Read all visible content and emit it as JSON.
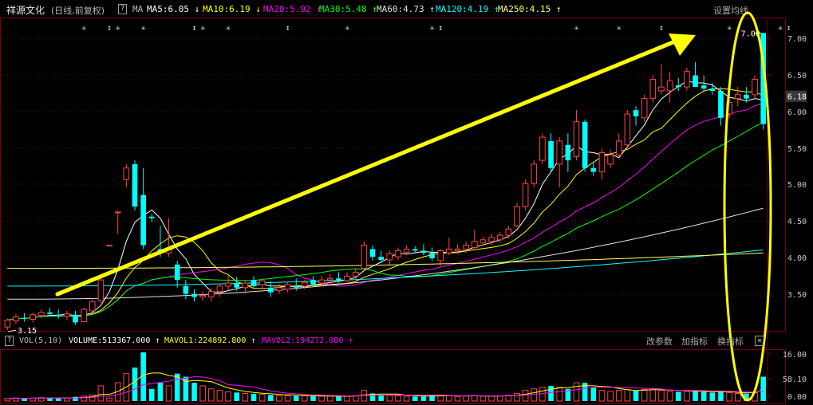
{
  "header": {
    "stock_name": "祥源文化",
    "mode": "(日线,前复权)",
    "help": "?",
    "ma_label": "MA",
    "ma_items": [
      {
        "text": "MA5:6.05 ↓",
        "color": "#ffffff"
      },
      {
        "text": "MA10:6.19 ↓",
        "color": "#ffff00"
      },
      {
        "text": "MA20:5.92 ↑",
        "color": "#ff00ff"
      },
      {
        "text": "MA30:5.48 ↑",
        "color": "#00ff00"
      },
      {
        "text": "MA60:4.73 ↑",
        "color": "#e0e0e0"
      },
      {
        "text": "MA120:4.19 ↑",
        "color": "#00ffff"
      },
      {
        "text": "MA250:4.15 ↑",
        "color": "#ffff66"
      }
    ],
    "settings": "设置均线"
  },
  "annotations": {
    "high_label": "7.00",
    "low_label": "3.15",
    "last_price": "6.18"
  },
  "volume_header": {
    "help": "?",
    "indicator": "VOL(5,10)",
    "volume": "VOLUME:513367.000 ↑",
    "mavol1": "MAVOL1:224892.800 ↑",
    "mavol2": "MAVOL2:194272.000 ↑",
    "btn_params": "改参数",
    "btn_add": "加指标",
    "btn_switch": "换指标",
    "btn_close": "×"
  },
  "chart_data": {
    "type": "candlestick",
    "price_axis": {
      "ticks": [
        "7.00",
        "6.50",
        "6.00",
        "5.50",
        "5.00",
        "4.50",
        "4.00",
        "3.50"
      ],
      "range": [
        3.13,
        7.2
      ]
    },
    "volume_axis": {
      "ticks": [
        "16.00",
        "58.10",
        "0.00"
      ],
      "range": [
        0,
        16.0
      ]
    },
    "candles": [
      {
        "o": 3.19,
        "h": 3.3,
        "l": 3.15,
        "c": 3.28,
        "v": 0.8
      },
      {
        "o": 3.27,
        "h": 3.36,
        "l": 3.23,
        "c": 3.32,
        "v": 1.0
      },
      {
        "o": 3.31,
        "h": 3.37,
        "l": 3.26,
        "c": 3.3,
        "v": 0.9
      },
      {
        "o": 3.29,
        "h": 3.38,
        "l": 3.25,
        "c": 3.35,
        "v": 1.0
      },
      {
        "o": 3.34,
        "h": 3.42,
        "l": 3.3,
        "c": 3.38,
        "v": 1.1
      },
      {
        "o": 3.38,
        "h": 3.44,
        "l": 3.33,
        "c": 3.36,
        "v": 1.0
      },
      {
        "o": 3.35,
        "h": 3.42,
        "l": 3.3,
        "c": 3.33,
        "v": 0.9
      },
      {
        "o": 3.33,
        "h": 3.4,
        "l": 3.28,
        "c": 3.36,
        "v": 1.0
      },
      {
        "o": 3.35,
        "h": 3.4,
        "l": 3.22,
        "c": 3.25,
        "v": 1.4
      },
      {
        "o": 3.26,
        "h": 3.44,
        "l": 3.25,
        "c": 3.42,
        "v": 1.6
      },
      {
        "o": 3.4,
        "h": 3.55,
        "l": 3.38,
        "c": 3.52,
        "v": 2.0
      },
      {
        "o": 3.53,
        "h": 3.85,
        "l": 3.5,
        "c": 3.8,
        "v": 5.0
      },
      {
        "o": 4.25,
        "h": 4.25,
        "l": 4.25,
        "c": 4.25,
        "v": 1.0
      },
      {
        "o": 4.68,
        "h": 4.7,
        "l": 4.4,
        "c": 4.68,
        "v": 6.0
      },
      {
        "o": 5.1,
        "h": 5.3,
        "l": 5.0,
        "c": 5.25,
        "v": 9.0
      },
      {
        "o": 5.3,
        "h": 5.35,
        "l": 4.7,
        "c": 4.75,
        "v": 11.0
      },
      {
        "o": 4.9,
        "h": 5.25,
        "l": 4.2,
        "c": 4.25,
        "v": 16.0
      },
      {
        "o": 4.62,
        "h": 4.65,
        "l": 4.55,
        "c": 4.6,
        "v": 4.0
      },
      {
        "o": 4.2,
        "h": 4.5,
        "l": 4.1,
        "c": 4.15,
        "v": 6.0
      },
      {
        "o": 4.15,
        "h": 4.6,
        "l": 4.1,
        "c": 4.2,
        "v": 5.0
      },
      {
        "o": 4.0,
        "h": 4.05,
        "l": 3.7,
        "c": 3.8,
        "v": 9.0
      },
      {
        "o": 3.72,
        "h": 3.8,
        "l": 3.55,
        "c": 3.62,
        "v": 8.0
      },
      {
        "o": 3.62,
        "h": 3.68,
        "l": 3.52,
        "c": 3.58,
        "v": 6.0
      },
      {
        "o": 3.58,
        "h": 3.65,
        "l": 3.53,
        "c": 3.6,
        "v": 5.0
      },
      {
        "o": 3.58,
        "h": 3.7,
        "l": 3.52,
        "c": 3.65,
        "v": 4.0
      },
      {
        "o": 3.65,
        "h": 3.75,
        "l": 3.58,
        "c": 3.72,
        "v": 3.5
      },
      {
        "o": 3.72,
        "h": 3.85,
        "l": 3.66,
        "c": 3.76,
        "v": 3.0
      },
      {
        "o": 3.76,
        "h": 3.84,
        "l": 3.66,
        "c": 3.7,
        "v": 2.8
      },
      {
        "o": 3.7,
        "h": 3.8,
        "l": 3.62,
        "c": 3.76,
        "v": 2.5
      },
      {
        "o": 3.8,
        "h": 3.85,
        "l": 3.7,
        "c": 3.72,
        "v": 2.4
      },
      {
        "o": 3.74,
        "h": 3.82,
        "l": 3.68,
        "c": 3.79,
        "v": 2.2
      },
      {
        "o": 3.7,
        "h": 3.78,
        "l": 3.58,
        "c": 3.64,
        "v": 2.0
      },
      {
        "o": 3.66,
        "h": 3.75,
        "l": 3.62,
        "c": 3.7,
        "v": 1.8
      },
      {
        "o": 3.68,
        "h": 3.78,
        "l": 3.64,
        "c": 3.74,
        "v": 1.8
      },
      {
        "o": 3.72,
        "h": 3.82,
        "l": 3.66,
        "c": 3.7,
        "v": 1.7
      },
      {
        "o": 3.72,
        "h": 3.8,
        "l": 3.68,
        "c": 3.77,
        "v": 1.7
      },
      {
        "o": 3.8,
        "h": 3.85,
        "l": 3.72,
        "c": 3.74,
        "v": 1.6
      },
      {
        "o": 3.76,
        "h": 3.85,
        "l": 3.72,
        "c": 3.8,
        "v": 1.6
      },
      {
        "o": 3.8,
        "h": 3.88,
        "l": 3.74,
        "c": 3.82,
        "v": 1.6
      },
      {
        "o": 3.82,
        "h": 3.9,
        "l": 3.76,
        "c": 3.79,
        "v": 1.5
      },
      {
        "o": 3.79,
        "h": 3.9,
        "l": 3.76,
        "c": 3.85,
        "v": 1.6
      },
      {
        "o": 3.85,
        "h": 3.95,
        "l": 3.8,
        "c": 3.9,
        "v": 1.8
      },
      {
        "o": 3.95,
        "h": 4.3,
        "l": 3.92,
        "c": 4.25,
        "v": 3.5
      },
      {
        "o": 4.2,
        "h": 4.25,
        "l": 4.05,
        "c": 4.1,
        "v": 2.5
      },
      {
        "o": 4.1,
        "h": 4.18,
        "l": 4.02,
        "c": 4.06,
        "v": 2.0
      },
      {
        "o": 4.06,
        "h": 4.18,
        "l": 4.0,
        "c": 4.14,
        "v": 1.8
      },
      {
        "o": 4.1,
        "h": 4.22,
        "l": 4.06,
        "c": 4.18,
        "v": 1.7
      },
      {
        "o": 4.16,
        "h": 4.25,
        "l": 4.12,
        "c": 4.2,
        "v": 1.6
      },
      {
        "o": 4.2,
        "h": 4.24,
        "l": 4.16,
        "c": 4.18,
        "v": 1.5
      },
      {
        "o": 4.18,
        "h": 4.26,
        "l": 4.12,
        "c": 4.15,
        "v": 1.5
      },
      {
        "o": 4.15,
        "h": 4.22,
        "l": 4.05,
        "c": 4.08,
        "v": 1.8
      },
      {
        "o": 4.05,
        "h": 4.2,
        "l": 3.98,
        "c": 4.18,
        "v": 2.0
      },
      {
        "o": 4.15,
        "h": 4.35,
        "l": 4.12,
        "c": 4.2,
        "v": 1.8
      },
      {
        "o": 4.18,
        "h": 4.26,
        "l": 4.14,
        "c": 4.2,
        "v": 1.5
      },
      {
        "o": 4.2,
        "h": 4.3,
        "l": 4.15,
        "c": 4.25,
        "v": 1.6
      },
      {
        "o": 4.22,
        "h": 4.45,
        "l": 4.18,
        "c": 4.3,
        "v": 1.8
      },
      {
        "o": 4.28,
        "h": 4.36,
        "l": 4.25,
        "c": 4.32,
        "v": 1.6
      },
      {
        "o": 4.3,
        "h": 4.4,
        "l": 4.25,
        "c": 4.35,
        "v": 1.6
      },
      {
        "o": 4.32,
        "h": 4.42,
        "l": 4.28,
        "c": 4.38,
        "v": 1.7
      },
      {
        "o": 4.38,
        "h": 4.5,
        "l": 4.34,
        "c": 4.46,
        "v": 1.9
      },
      {
        "o": 4.5,
        "h": 4.8,
        "l": 4.48,
        "c": 4.75,
        "v": 2.5
      },
      {
        "o": 4.75,
        "h": 5.1,
        "l": 4.7,
        "c": 5.05,
        "v": 3.5
      },
      {
        "o": 5.05,
        "h": 5.35,
        "l": 5.0,
        "c": 5.3,
        "v": 4.0
      },
      {
        "o": 5.35,
        "h": 5.7,
        "l": 5.3,
        "c": 5.65,
        "v": 4.5
      },
      {
        "o": 5.6,
        "h": 5.7,
        "l": 5.2,
        "c": 5.25,
        "v": 5.0
      },
      {
        "o": 5.3,
        "h": 5.65,
        "l": 5.0,
        "c": 5.6,
        "v": 4.5
      },
      {
        "o": 5.55,
        "h": 5.7,
        "l": 5.2,
        "c": 5.35,
        "v": 4.0
      },
      {
        "o": 5.4,
        "h": 6.0,
        "l": 5.35,
        "c": 5.85,
        "v": 6.0
      },
      {
        "o": 5.85,
        "h": 5.88,
        "l": 5.2,
        "c": 5.25,
        "v": 6.0
      },
      {
        "o": 5.25,
        "h": 5.32,
        "l": 5.15,
        "c": 5.2,
        "v": 4.5
      },
      {
        "o": 5.2,
        "h": 5.5,
        "l": 5.1,
        "c": 5.45,
        "v": 3.5
      },
      {
        "o": 5.3,
        "h": 5.48,
        "l": 5.25,
        "c": 5.42,
        "v": 3.2
      },
      {
        "o": 5.42,
        "h": 5.7,
        "l": 5.4,
        "c": 5.6,
        "v": 3.5
      },
      {
        "o": 5.55,
        "h": 6.0,
        "l": 5.52,
        "c": 5.95,
        "v": 3.8
      },
      {
        "o": 6.0,
        "h": 6.05,
        "l": 5.8,
        "c": 5.92,
        "v": 3.5
      },
      {
        "o": 5.9,
        "h": 6.2,
        "l": 5.85,
        "c": 6.15,
        "v": 3.8
      },
      {
        "o": 6.15,
        "h": 6.45,
        "l": 6.1,
        "c": 6.4,
        "v": 4.0
      },
      {
        "o": 6.25,
        "h": 6.6,
        "l": 6.2,
        "c": 6.3,
        "v": 3.5
      },
      {
        "o": 6.25,
        "h": 6.5,
        "l": 6.1,
        "c": 6.38,
        "v": 3.2
      },
      {
        "o": 6.32,
        "h": 6.42,
        "l": 6.25,
        "c": 6.3,
        "v": 3.0
      },
      {
        "o": 6.3,
        "h": 6.55,
        "l": 6.25,
        "c": 6.5,
        "v": 3.2
      },
      {
        "o": 6.45,
        "h": 6.62,
        "l": 6.4,
        "c": 6.3,
        "v": 3.4
      },
      {
        "o": 6.32,
        "h": 6.45,
        "l": 6.25,
        "c": 6.28,
        "v": 3.0
      },
      {
        "o": 6.28,
        "h": 6.35,
        "l": 6.2,
        "c": 6.25,
        "v": 2.8
      },
      {
        "o": 6.25,
        "h": 6.3,
        "l": 5.8,
        "c": 5.9,
        "v": 3.2
      },
      {
        "o": 5.95,
        "h": 6.2,
        "l": 5.9,
        "c": 6.1,
        "v": 2.8
      },
      {
        "o": 6.15,
        "h": 6.3,
        "l": 6.05,
        "c": 6.2,
        "v": 2.5
      },
      {
        "o": 6.2,
        "h": 6.3,
        "l": 6.1,
        "c": 6.15,
        "v": 2.5
      },
      {
        "o": 6.2,
        "h": 6.45,
        "l": 6.15,
        "c": 6.4,
        "v": 2.8
      },
      {
        "o": 7.0,
        "h": 7.0,
        "l": 5.75,
        "c": 5.82,
        "v": 8.0
      }
    ],
    "moving_averages": [
      {
        "name": "MA5",
        "color": "#ffffff",
        "last": 6.05
      },
      {
        "name": "MA10",
        "color": "#ffff00",
        "last": 6.19
      },
      {
        "name": "MA20",
        "color": "#ff00ff",
        "last": 5.92
      },
      {
        "name": "MA30",
        "color": "#00ff00",
        "last": 5.48
      },
      {
        "name": "MA60",
        "color": "#e0e0e0",
        "last": 4.73
      },
      {
        "name": "MA120",
        "color": "#00ffff",
        "last": 4.19
      },
      {
        "name": "MA250",
        "color": "#ffff66",
        "last": 4.15
      }
    ],
    "volume_mas": [
      {
        "name": "MAVOL1",
        "color": "#ffff00",
        "period": 5
      },
      {
        "name": "MAVOL2",
        "color": "#ff00ff",
        "period": 10
      }
    ],
    "colors": {
      "up": "#ff4444",
      "down": "#00ffff",
      "grid": "#7a0000",
      "arrow": "#ffff00"
    }
  }
}
